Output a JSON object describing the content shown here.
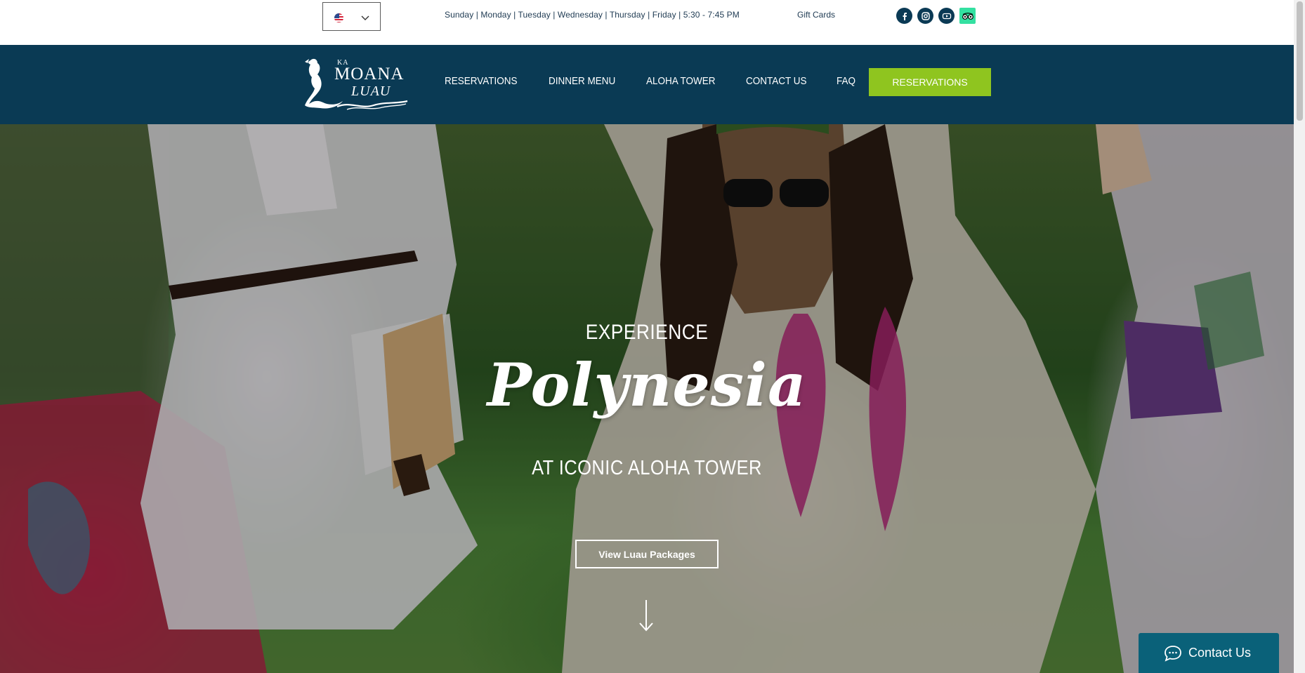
{
  "topbar": {
    "language": {
      "flag": "us-flag-icon"
    },
    "hours": "Sunday |  Monday | Tuesday  | Wednesday  | Thursday | Friday | 5:30 - 7:45 PM",
    "gift_cards": "Gift Cards",
    "socials": [
      "facebook-icon",
      "instagram-icon",
      "youtube-icon",
      "tripadvisor-icon"
    ]
  },
  "logo": {
    "ka": "KA",
    "moana": "MOANA",
    "luau": "LUAU"
  },
  "nav": {
    "items": [
      {
        "label": "RESERVATIONS"
      },
      {
        "label": "DINNER MENU"
      },
      {
        "label": "ALOHA TOWER"
      },
      {
        "label": "CONTACT US"
      },
      {
        "label": "FAQ"
      }
    ],
    "cta": "RESERVATIONS"
  },
  "hero": {
    "line1": "EXPERIENCE",
    "line2": "Polynesia",
    "line3": "AT ICONIC ALOHA TOWER",
    "button": "View Luau Packages"
  },
  "chat": {
    "label": "Contact Us"
  },
  "colors": {
    "nav_bg": "#0a3a54",
    "cta_green": "#8fc51f",
    "chat_bg": "#0a6179",
    "tripadvisor": "#34e0a1"
  }
}
